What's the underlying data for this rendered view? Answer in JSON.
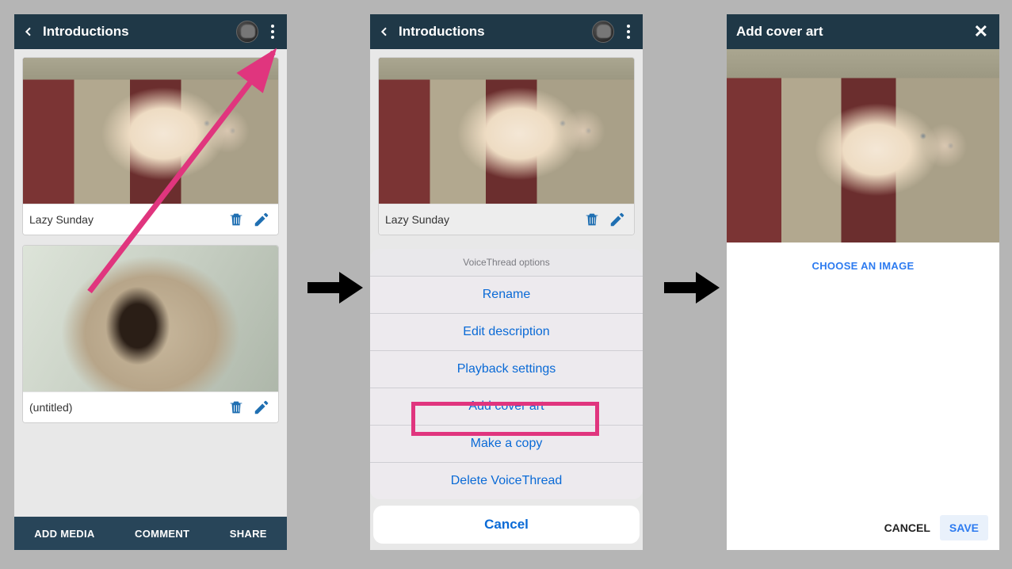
{
  "phone1": {
    "title": "Introductions",
    "card1_title": "Lazy Sunday",
    "card2_title": "(untitled)",
    "bottom": {
      "add": "ADD MEDIA",
      "comment": "COMMENT",
      "share": "SHARE"
    }
  },
  "phone2": {
    "title": "Introductions",
    "card1_title": "Lazy Sunday",
    "sheet_title": "VoiceThread options",
    "items": {
      "rename": "Rename",
      "edit_desc": "Edit description",
      "playback": "Playback settings",
      "cover": "Add cover art",
      "copy": "Make a copy",
      "delete": "Delete VoiceThread"
    },
    "cancel": "Cancel"
  },
  "phone3": {
    "title": "Add cover art",
    "choose": "CHOOSE AN IMAGE",
    "cancel": "CANCEL",
    "save": "SAVE"
  }
}
